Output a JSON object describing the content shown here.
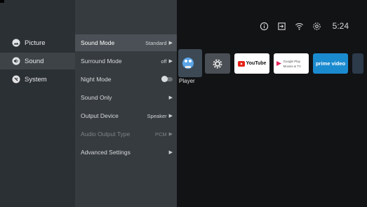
{
  "status_bar": {
    "time": "5:24",
    "icons": [
      "info-icon",
      "input-icon",
      "wifi-icon",
      "settings-icon"
    ]
  },
  "home": {
    "apps": [
      {
        "name": "Player",
        "icon": "player-icon"
      },
      {
        "name": "",
        "icon": "gear-icon"
      },
      {
        "name": "YouTube",
        "icon": "youtube-icon"
      },
      {
        "name": "Google Play Movies & TV",
        "icon": "google-play-movies-icon"
      },
      {
        "name": "prime video",
        "icon": "prime-video-icon"
      }
    ],
    "player_label": "Player"
  },
  "categories": [
    {
      "label": "Picture",
      "icon": "picture-icon"
    },
    {
      "label": "Sound",
      "icon": "sound-icon",
      "selected": true
    },
    {
      "label": "System",
      "icon": "system-icon"
    }
  ],
  "sound_menu": [
    {
      "label": "Sound Mode",
      "value": "Standard",
      "chevron": true,
      "focused": true
    },
    {
      "label": "Surround Mode",
      "value": "off",
      "chevron": true
    },
    {
      "label": "Night Mode",
      "value": "",
      "toggle": "off"
    },
    {
      "label": "Sound Only",
      "value": "",
      "chevron": true
    },
    {
      "label": "Output Device",
      "value": "Speaker",
      "chevron": true
    },
    {
      "label": "Audio Output Type",
      "value": "PCM",
      "chevron": true,
      "disabled": true
    },
    {
      "label": "Advanced Settings",
      "value": "",
      "chevron": true
    }
  ],
  "colors": {
    "category_panel": "#2b3034",
    "submenu_panel": "#363b3f",
    "focus": "#4a5055",
    "prime_blue": "#1b8bd0"
  }
}
